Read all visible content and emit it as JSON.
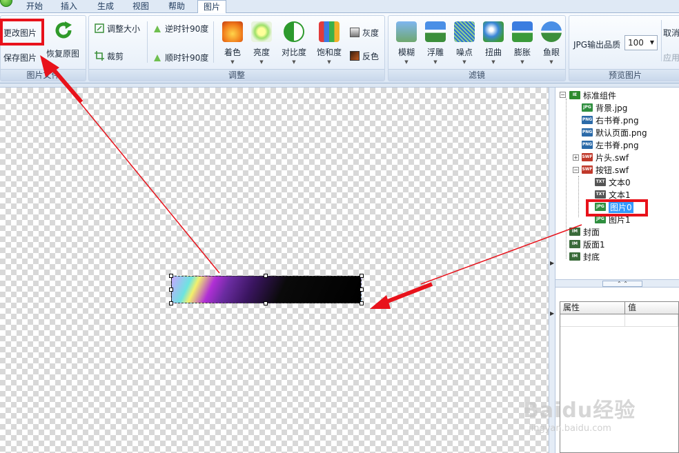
{
  "menu": {
    "items": [
      {
        "label": "开始"
      },
      {
        "label": "插入"
      },
      {
        "label": "生成"
      },
      {
        "label": "视图"
      },
      {
        "label": "帮助"
      },
      {
        "label": "图片"
      }
    ]
  },
  "ribbon": {
    "file_group": {
      "label": "图片文件",
      "change_image": "更改图片",
      "save_image": "保存图片",
      "restore_original": "恢复原图"
    },
    "adjust_group": {
      "label": "调整",
      "resize": "调整大小",
      "crop": "裁剪",
      "rotate_ccw": "逆时针90度",
      "rotate_cw": "顺时针90度",
      "tint": "着色",
      "brightness": "亮度",
      "contrast": "对比度",
      "saturation": "饱和度",
      "grayscale": "灰度",
      "invert": "反色"
    },
    "filter_group": {
      "label": "滤镜",
      "blur": "模糊",
      "emboss": "浮雕",
      "noise": "噪点",
      "twist": "扭曲",
      "expand": "膨胀",
      "fisheye": "鱼眼"
    },
    "preview_group": {
      "label": "预览图片",
      "jpg_quality_label": "JPG输出品质",
      "jpg_quality_value": "100",
      "cancel": "取消",
      "apply": "应用"
    }
  },
  "tree": {
    "root": "标准组件",
    "nodes": [
      {
        "label": "背景.jpg",
        "type": "JPG"
      },
      {
        "label": "右书脊.png",
        "type": "PNG"
      },
      {
        "label": "默认页面.png",
        "type": "PNG"
      },
      {
        "label": "左书脊.png",
        "type": "PNG"
      },
      {
        "label": "片头.swf",
        "type": "SWF"
      },
      {
        "label": "按钮.swf",
        "type": "SWF"
      },
      {
        "label": "文本0",
        "type": "TXT"
      },
      {
        "label": "文本1",
        "type": "TXT"
      },
      {
        "label": "图片0",
        "type": "JPG"
      },
      {
        "label": "图片1",
        "type": "JPG"
      },
      {
        "label": "封面",
        "type": "IM"
      },
      {
        "label": "版面1",
        "type": "IM"
      },
      {
        "label": "封底",
        "type": "IM"
      }
    ]
  },
  "properties": {
    "col_property": "属性",
    "col_value": "值"
  },
  "watermark": {
    "brand": "Baidu经验",
    "url": "jingyan.baidu.com"
  },
  "colors": {
    "annotation_red": "#e8121b",
    "selection_blue": "#3399ff",
    "ribbon_bg": "#dce7f5"
  }
}
